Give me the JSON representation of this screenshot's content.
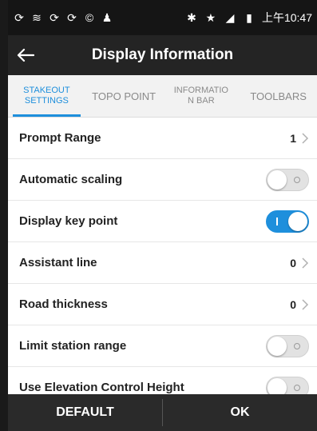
{
  "status_bar": {
    "left_icons": [
      "sync-icon",
      "wifi-icon",
      "sync-icon",
      "sync-icon",
      "copyright-icon",
      "android-icon"
    ],
    "right_icons": [
      "bluetooth-icon",
      "star-icon",
      "signal-icon",
      "battery-icon"
    ],
    "time": "上午10:47"
  },
  "app_bar": {
    "title": "Display Information"
  },
  "tabs": [
    {
      "label": "STAKEOUT\nSETTINGS",
      "active": true
    },
    {
      "label": "TOPO POINT",
      "active": false
    },
    {
      "label": "INFORMATIO\nN BAR",
      "active": false
    },
    {
      "label": "TOOLBARS",
      "active": false
    }
  ],
  "settings": [
    {
      "label": "Prompt Range",
      "type": "value",
      "value": "1"
    },
    {
      "label": "Automatic scaling",
      "type": "toggle",
      "on": false
    },
    {
      "label": "Display key point",
      "type": "toggle",
      "on": true
    },
    {
      "label": "Assistant line",
      "type": "value",
      "value": "0"
    },
    {
      "label": "Road thickness",
      "type": "value",
      "value": "0"
    },
    {
      "label": "Limit station range",
      "type": "toggle",
      "on": false
    },
    {
      "label": "Use Elevation Control Height",
      "type": "toggle",
      "on": false
    }
  ],
  "bottom_bar": {
    "default_label": "DEFAULT",
    "ok_label": "OK"
  },
  "colors": {
    "accent": "#1e8fdc",
    "status_bar": "#151515",
    "app_bar": "#242424",
    "bottom_bar": "#2a2a2a"
  }
}
